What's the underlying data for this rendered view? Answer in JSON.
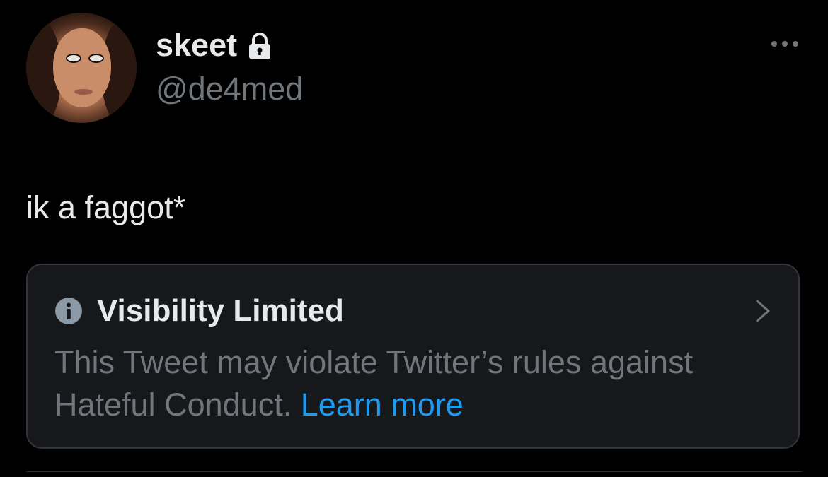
{
  "user": {
    "display_name": "skeet",
    "handle": "@de4med",
    "protected_icon": "lock-icon",
    "avatar_icon": "profile-photo"
  },
  "tweet": {
    "text": "ik a faggot*",
    "more_icon": "more-horizontal-icon"
  },
  "notice": {
    "icon": "info-icon",
    "title": "Visibility Limited",
    "body": "This Tweet may violate Twitter’s rules against Hateful Conduct.",
    "link_label": "Learn more",
    "chevron_icon": "chevron-right-icon"
  },
  "colors": {
    "background": "#000000",
    "primary_text": "#e7e9ea",
    "secondary_text": "#71767b",
    "link": "#1d9bf0",
    "card_background": "#16181c",
    "card_border": "#333639"
  }
}
